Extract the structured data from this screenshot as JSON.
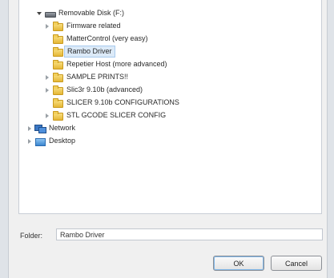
{
  "tree": {
    "items": [
      {
        "label": "Removable Disk (F:)",
        "icon": "drive-icon",
        "expanded": true,
        "selected": false
      },
      {
        "label": "Firmware related",
        "icon": "folder-icon",
        "expandable": true,
        "selected": false
      },
      {
        "label": "MatterControl (very easy)",
        "icon": "folder-icon",
        "expandable": false,
        "selected": false
      },
      {
        "label": "Rambo Driver",
        "icon": "folder-icon",
        "expandable": false,
        "selected": true
      },
      {
        "label": "Repetier Host (more advanced)",
        "icon": "folder-icon",
        "expandable": false,
        "selected": false
      },
      {
        "label": "SAMPLE PRINTS!!",
        "icon": "folder-icon",
        "expandable": true,
        "selected": false
      },
      {
        "label": "Slic3r 9.10b (advanced)",
        "icon": "folder-icon",
        "expandable": true,
        "selected": false
      },
      {
        "label": "SLICER 9.10b CONFIGURATIONS",
        "icon": "folder-icon",
        "expandable": false,
        "selected": false
      },
      {
        "label": "STL GCODE SLICER CONFIG",
        "icon": "folder-icon",
        "expandable": true,
        "selected": false
      },
      {
        "label": "Network",
        "icon": "network-icon",
        "expandable": true,
        "selected": false
      },
      {
        "label": "Desktop",
        "icon": "desktop-icon",
        "expandable": true,
        "selected": false
      }
    ]
  },
  "folder_field": {
    "label": "Folder:",
    "value": "Rambo Driver"
  },
  "buttons": {
    "ok": "OK",
    "cancel": "Cancel"
  },
  "colors": {
    "selection": "#dceaf8",
    "background": "#f0f0f0"
  }
}
